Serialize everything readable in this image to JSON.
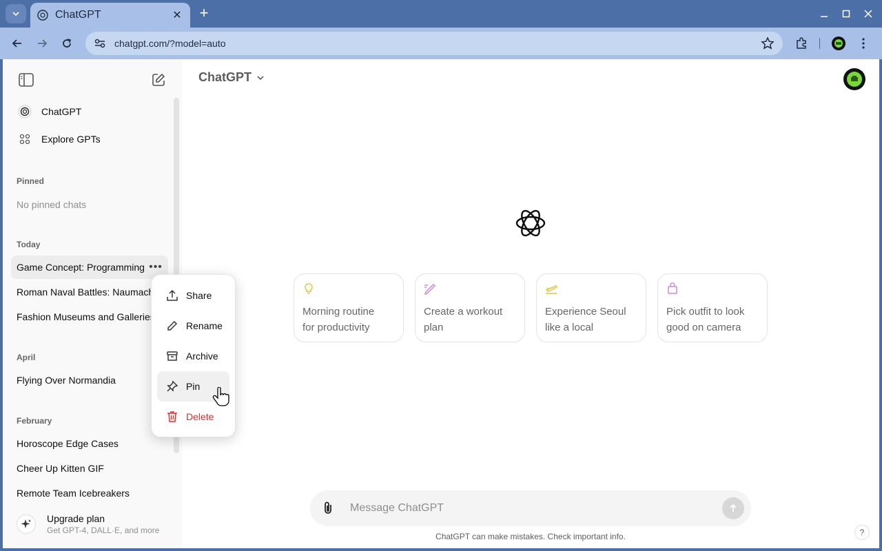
{
  "browser": {
    "tab_title": "ChatGPT",
    "url": "chatgpt.com/?model=auto"
  },
  "sidebar": {
    "nav": [
      {
        "label": "ChatGPT",
        "icon": "chatgpt-logo-icon"
      },
      {
        "label": "Explore GPTs",
        "icon": "grid-icon"
      }
    ],
    "pinned_heading": "Pinned",
    "pinned_empty": "No pinned chats",
    "sections": [
      {
        "heading": "Today",
        "chats": [
          "Game Concept: Programming",
          "Roman Naval Battles: Naumach",
          "Fashion Museums and Galleries"
        ]
      },
      {
        "heading": "April",
        "chats": [
          "Flying Over Normandia"
        ]
      },
      {
        "heading": "February",
        "chats": [
          "Horoscope Edge Cases",
          "Cheer Up Kitten GIF",
          "Remote Team Icebreakers"
        ]
      }
    ],
    "upgrade": {
      "title": "Upgrade plan",
      "subtitle": "Get GPT-4, DALL·E, and more"
    }
  },
  "context_menu": {
    "items": [
      {
        "label": "Share",
        "icon": "share-icon"
      },
      {
        "label": "Rename",
        "icon": "pencil-icon"
      },
      {
        "label": "Archive",
        "icon": "archive-icon"
      },
      {
        "label": "Pin",
        "icon": "pin-icon"
      },
      {
        "label": "Delete",
        "icon": "trash-icon"
      }
    ]
  },
  "main": {
    "model_name": "ChatGPT",
    "cards": [
      {
        "text_line1": "Morning routine",
        "text_line2": "for productivity",
        "icon_color": "#e2c541"
      },
      {
        "text_line1": "Create a workout",
        "text_line2": "plan",
        "icon_color": "#cb8bd0"
      },
      {
        "text_line1": "Experience Seoul",
        "text_line2": "like a local",
        "icon_color": "#e2c541"
      },
      {
        "text_line1": "Pick outfit to look",
        "text_line2": "good on camera",
        "icon_color": "#cb8bd0"
      }
    ],
    "composer_placeholder": "Message ChatGPT",
    "disclaimer": "ChatGPT can make mistakes. Check important info.",
    "help_label": "?"
  },
  "colors": {
    "browser_frame": "#4c6fa8",
    "toolbar": "#a8c0e8",
    "delete_red": "#e02e2a"
  }
}
